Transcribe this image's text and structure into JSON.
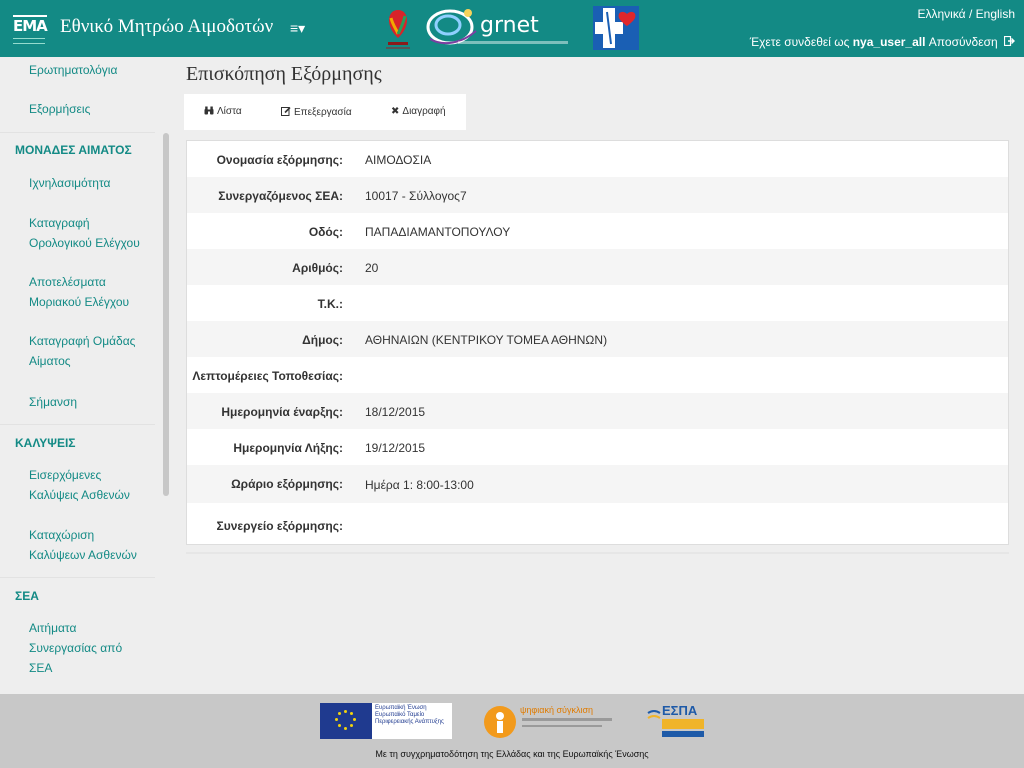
{
  "header": {
    "logo_text": "EMA",
    "brand": "Εθνικό Μητρώο Αιμοδοτών",
    "menu_glyph": "≡▾",
    "partner_logo_text": "grnet",
    "lang_el": "Ελληνικά",
    "lang_sep": " / ",
    "lang_en": "English",
    "logged_prefix": "Έχετε συνδεθεί ως ",
    "username": "nya_user_all",
    "logout": "Αποσύνδεση"
  },
  "sidebar": {
    "items": [
      {
        "label": "Ερωτηματολόγια"
      },
      {
        "label": "Εξορμήσεις"
      }
    ],
    "section_blood": "ΜΟΝΑΔΕΣ ΑΙΜΑΤΟΣ",
    "blood_items": [
      {
        "label": "Ιχνηλασιμότητα"
      },
      {
        "label": "Καταγραφή Ορολογικού Ελέγχου"
      },
      {
        "label": "Αποτελέσματα Μοριακού Ελέγχου"
      },
      {
        "label": "Καταγραφή Ομάδας Αίματος"
      },
      {
        "label": "Σήμανση"
      }
    ],
    "section_coverage": "ΚΑΛΥΨΕΙΣ",
    "coverage_items": [
      {
        "label": "Εισερχόμενες Καλύψεις Ασθενών"
      },
      {
        "label": "Καταχώριση Καλύψεων Ασθενών"
      }
    ],
    "section_sea": "ΣΕΑ",
    "sea_items": [
      {
        "label": "Αιτήματα Συνεργασίας από ΣΕΑ"
      }
    ]
  },
  "main": {
    "title": "Επισκόπηση Εξόρμησης",
    "toolbar": {
      "list": "Λίστα",
      "edit": "Επεξεργασία",
      "delete": "Διαγραφή"
    },
    "fields": [
      {
        "label": "Ονομασία εξόρμησης:",
        "value": "ΑΙΜΟΔΟΣΙΑ"
      },
      {
        "label": "Συνεργαζόμενος ΣΕΑ:",
        "value": "10017 - Σύλλογος7"
      },
      {
        "label": "Οδός:",
        "value": "ΠΑΠΑΔΙΑΜΑΝΤΟΠΟΥΛΟΥ"
      },
      {
        "label": "Αριθμός:",
        "value": "20"
      },
      {
        "label": "Τ.Κ.:",
        "value": ""
      },
      {
        "label": "Δήμος:",
        "value": "ΑΘΗΝΑΙΩΝ (ΚΕΝΤΡΙΚΟΥ ΤΟΜΕΑ ΑΘΗΝΩΝ)"
      },
      {
        "label": "Λεπτομέρειες Τοποθεσίας:",
        "value": ""
      },
      {
        "label": "Ημερομηνία έναρξης:",
        "value": "18/12/2015"
      },
      {
        "label": "Ημερομηνία Λήξης:",
        "value": "19/12/2015"
      },
      {
        "label": "Ωράριο εξόρμησης:",
        "value": "Ημέρα 1: 8:00-13:00"
      },
      {
        "label": "Συνεργείο εξόρμησης:",
        "value": ""
      }
    ]
  },
  "footer": {
    "eu_text_1": "Ευρωπαϊκή Ένωση",
    "eu_text_2": "Ευρωπαϊκό Ταμείο Περιφερειακής Ανάπτυξης",
    "digital_text": "ψηφιακή σύγκλιση",
    "espa_text": "ΕΣΠΑ",
    "caption": "Με τη συγχρηματοδότηση της Ελλάδας και της Ευρωπαϊκής Ένωσης"
  },
  "colors": {
    "accent": "#138a85",
    "background": "#eeeeee",
    "footer": "#c8c8c8"
  },
  "icons": {
    "list": "binoculars-icon",
    "edit": "edit-icon",
    "delete": "close-icon",
    "logout": "logout-icon"
  }
}
